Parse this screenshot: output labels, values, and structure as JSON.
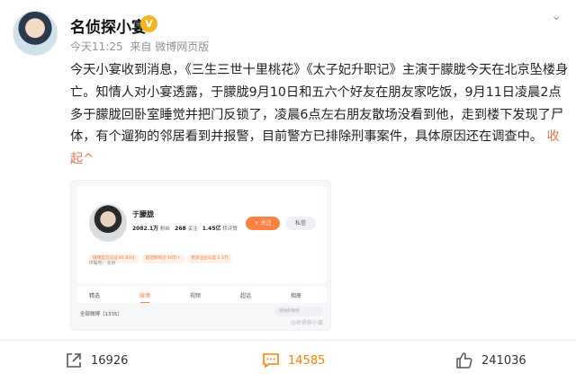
{
  "author": {
    "name": "名侦探小宴",
    "vip_icon": "vip-crown-icon",
    "time": "今天11:25",
    "source": "来自 微博网页版"
  },
  "post": {
    "text": "今天小宴收到消息，《三生三世十里桃花》《太子妃升职记》主演于朦胧今天在北京坠楼身亡。知情人对小宴透露，于朦胧9月10日和五六个好友在朋友家吃饭，9月11日凌晨2点多于朦胧回卧室睡觉并把门反锁了，凌晨6点左右朋友散场没看到他，走到楼下发现了尸体，有个遛狗的邻居看到并报警，目前警方已排除刑事案件，具体原因还在调查中。",
    "collapse_label": "收起",
    "collapse_icon": "chevron-up-icon"
  },
  "embed": {
    "name": "于朦胧",
    "followers": "2082.1万",
    "followers_label": "粉丝",
    "following": "268",
    "following_label": "关注",
    "likes": "1.45亿",
    "likes_label": "转评赞",
    "follow_label": "+ 关注",
    "message_label": "私信",
    "badges": [
      "微博官方认证 81.83分",
      "超话影响力 10万+",
      "更多企业认证 2.3万"
    ],
    "location": "IP属地：北京",
    "tabs": [
      "精选",
      "微博",
      "视频",
      "超话",
      "相册"
    ],
    "active_tab": 1,
    "all_posts": "全部微博（1335）",
    "search_placeholder": "搜他的微博",
    "watermark": "@名侦探小宴"
  },
  "actions": {
    "repost_count": "16926",
    "comment_count": "14585",
    "like_count": "241036"
  },
  "colors": {
    "accent": "#ff8200",
    "link": "#eb7350",
    "follow": "#ff8140"
  }
}
